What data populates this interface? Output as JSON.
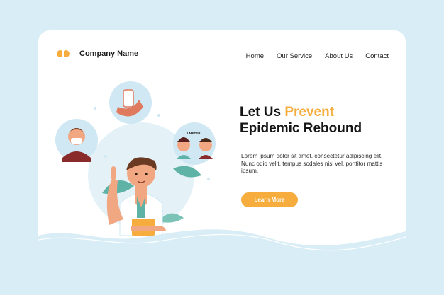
{
  "brand": {
    "name": "Company Name",
    "logo_color": "#f6ad3d"
  },
  "nav": {
    "items": [
      "Home",
      "Our Service",
      "About Us",
      "Contact"
    ]
  },
  "hero": {
    "title_part1": "Let Us ",
    "title_accent": "Prevent",
    "title_part2": "Epidemic Rebound",
    "body": "Lorem ipsum dolor sit amet, consectetur adipiscing elit.  Nunc odio velit, tempus sodales nisi vel, porttitor mattis ipsum.",
    "cta_label": "Learn More"
  },
  "illustration": {
    "sign_text": "1 METER"
  },
  "colors": {
    "background": "#d8edf5",
    "card": "#ffffff",
    "accent": "#f6ad3d",
    "text": "#151515",
    "illustration_blue": "#cfe8f3",
    "illustration_teal": "#5fb3a6"
  }
}
